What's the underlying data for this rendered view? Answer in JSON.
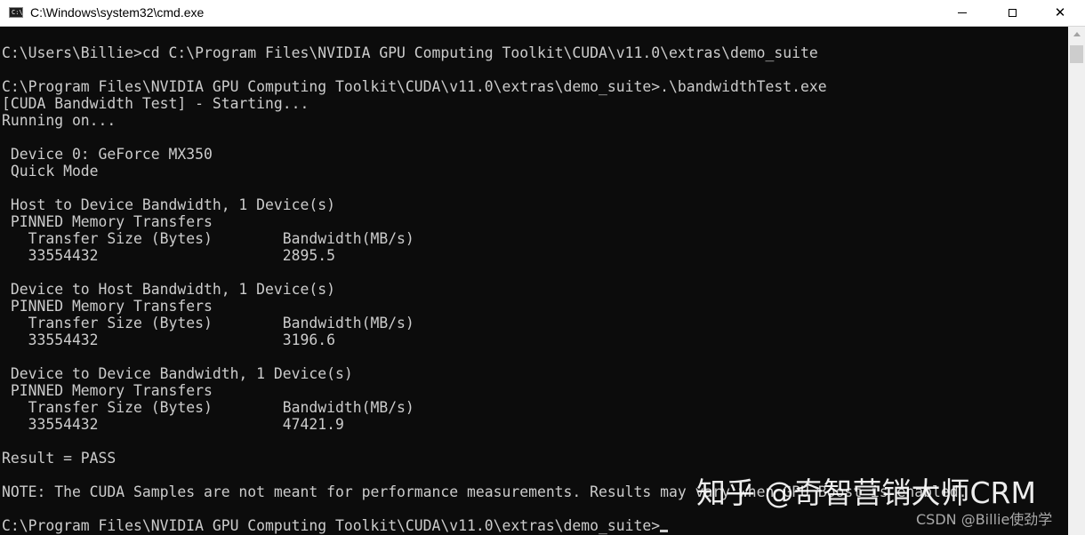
{
  "window": {
    "title": "C:\\Windows\\system32\\cmd.exe",
    "icon": "C:\\"
  },
  "controls": {
    "minimize_icon": "minimize-icon",
    "maximize_icon": "maximize-icon",
    "close_icon": "close-icon",
    "close_glyph": "✕"
  },
  "console": {
    "lines": [
      "C:\\Users\\Billie>cd C:\\Program Files\\NVIDIA GPU Computing Toolkit\\CUDA\\v11.0\\extras\\demo_suite",
      "C:\\Program Files\\NVIDIA GPU Computing Toolkit\\CUDA\\v11.0\\extras\\demo_suite>.\\bandwidthTest.exe",
      "[CUDA Bandwidth Test] - Starting...",
      "Running on...",
      " Device 0: GeForce MX350",
      " Quick Mode",
      " Host to Device Bandwidth, 1 Device(s)",
      " PINNED Memory Transfers",
      "   Transfer Size (Bytes)        Bandwidth(MB/s)",
      "   33554432                     2895.5",
      " Device to Host Bandwidth, 1 Device(s)",
      " PINNED Memory Transfers",
      "   Transfer Size (Bytes)        Bandwidth(MB/s)",
      "   33554432                     3196.6",
      " Device to Device Bandwidth, 1 Device(s)",
      " PINNED Memory Transfers",
      "   Transfer Size (Bytes)        Bandwidth(MB/s)",
      "   33554432                     47421.9",
      "Result = PASS",
      "NOTE: The CUDA Samples are not meant for performance measurements. Results may vary when GPU Boost is enabled.",
      "C:\\Program Files\\NVIDIA GPU Computing Toolkit\\CUDA\\v11.0\\extras\\demo_suite>"
    ]
  },
  "watermarks": {
    "zhihu": "知乎 @奇智营销大师CRM",
    "csdn": "CSDN @Billie使劲学"
  },
  "colors": {
    "console_bg": "#0c0c0c",
    "console_text": "#cccccc",
    "titlebar_bg": "#ffffff"
  }
}
